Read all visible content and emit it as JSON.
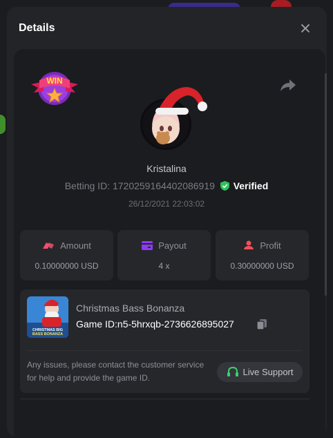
{
  "modal": {
    "title": "Details",
    "close_icon": "close-icon"
  },
  "badge": {
    "text": "WIN"
  },
  "user": {
    "name": "Kristalina",
    "betting_id_label": "Betting ID:",
    "betting_id": "1720259164402086919",
    "verified_label": "Verified",
    "date": "26/12/2021 22:03:02"
  },
  "stats": [
    {
      "label": "Amount",
      "value": "0.10000000 USD",
      "icon": "amount-icon",
      "color": "#f0506e"
    },
    {
      "label": "Payout",
      "value": "4 x",
      "icon": "payout-icon",
      "color": "#8c3cf0"
    },
    {
      "label": "Profit",
      "value": "0.30000000 USD",
      "icon": "profit-icon",
      "color": "#f0505a"
    }
  ],
  "game": {
    "name": "Christmas Bass Bonanza",
    "id_label": "Game ID:",
    "id": "n5-5hrxqb-2736626895027",
    "thumb_title": "CHRISTMAS BIG BASS BONANZA"
  },
  "support": {
    "message": "Any issues, please contact the customer service for help and provide the game ID.",
    "button_label": "Live Support"
  },
  "colors": {
    "background": "#1b1c1f",
    "card": "#26272b",
    "verified_green": "#2fc25b",
    "support_green": "#3bd16f"
  }
}
